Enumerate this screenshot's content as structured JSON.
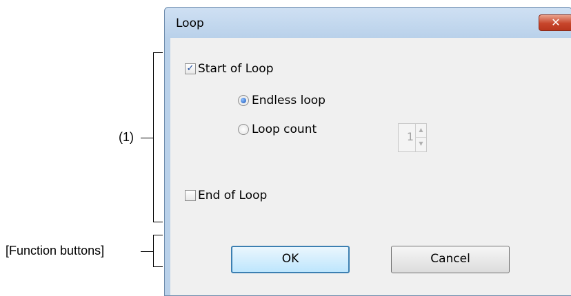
{
  "annotations": {
    "region_1": "(1)",
    "function_buttons": "[Function buttons]"
  },
  "window": {
    "title": "Loop",
    "close_glyph": "✕"
  },
  "options": {
    "start_of_loop": {
      "label": "Start of Loop",
      "checked": true
    },
    "endless_loop": {
      "label": "Endless loop",
      "selected": true
    },
    "loop_count": {
      "label": "Loop count",
      "selected": false,
      "value": "1",
      "enabled": false
    },
    "end_of_loop": {
      "label": "End of Loop",
      "checked": false
    }
  },
  "buttons": {
    "ok": "OK",
    "cancel": "Cancel"
  },
  "glyphs": {
    "checkmark": "✓",
    "spin_up": "▲",
    "spin_down": "▼"
  },
  "colors": {
    "title_bar": "#b9d1ea",
    "close_button": "#c7452b",
    "client_background": "#f0f0f0",
    "default_button_border": "#3c7fb1"
  }
}
